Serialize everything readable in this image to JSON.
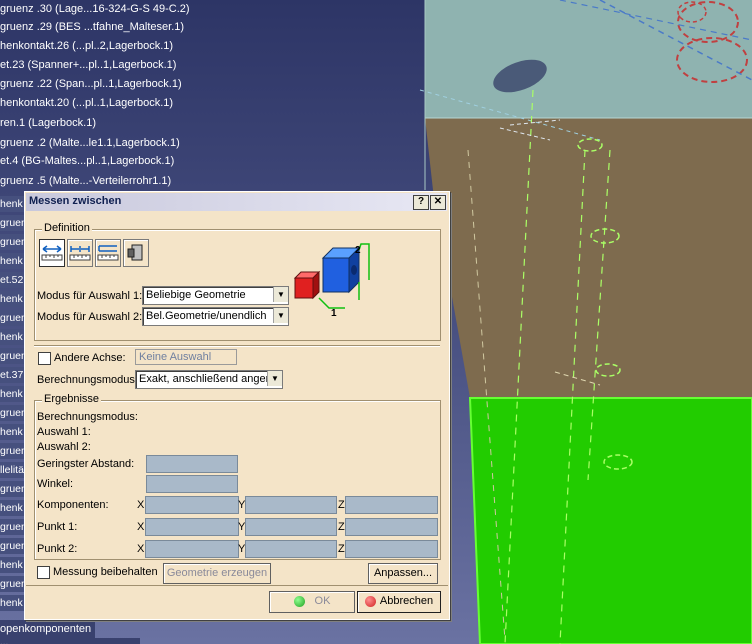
{
  "tree": {
    "items": [
      "gruenz .30 (Lage...16-324-G-S 49-C.2)",
      "gruenz .29 (BES ...tfahne_Malteser.1)",
      "henkontakt.26 (...pl..2,Lagerbock.1)",
      "et.23 (Spanner+...pl..1,Lagerbock.1)",
      "gruenz .22 (Span...pl..1,Lagerbock.1)",
      "henkontakt.20 (...pl..1,Lagerbock.1)",
      "ren.1 (Lagerbock.1)",
      "gruenz .2 (Malte...le1.1,Lagerbock.1)",
      "et.4 (BG-Maltes...pl..1,Lagerbock.1)",
      "gruenz .5 (Malte...-Verteilerrohr1.1)"
    ],
    "stubs": [
      "henk",
      "gruenz",
      "gruenz",
      "henk",
      "et.52",
      "henk",
      "gruenz",
      "henk",
      "gruenz",
      "et.37",
      "henk",
      "gruenz",
      "henk",
      "gruenz",
      "llelitä",
      "gruenz",
      "henk",
      "gruenz",
      "gruenz",
      "henk",
      "gruenz",
      "henk"
    ],
    "bottom_item": "openkomponenten",
    "bottom_item2": "..."
  },
  "dialog": {
    "title": "Messen zwischen",
    "help_btn": "?",
    "close_btn": "✕",
    "definition": {
      "legend": "Definition",
      "tool_icons": [
        "measure-between-icon",
        "measure-chain-icon",
        "measure-fan-icon",
        "measure-item-icon"
      ],
      "mode1_label": "Modus für Auswahl 1:",
      "mode1_value": "Beliebige Geometrie",
      "mode2_label": "Modus für Auswahl 2:",
      "mode2_value": "Bel.Geometrie/unendlich",
      "diagram_label_1": "1",
      "diagram_label_2": "2",
      "other_axis_label": "Andere Achse:",
      "other_axis_placeholder": "Keine Auswahl",
      "calc_mode_label": "Berechnungsmodus:",
      "calc_mode_value": "Exakt, anschließend angen"
    },
    "results": {
      "legend": "Ergebnisse",
      "calc_mode": "Berechnungsmodus:",
      "sel1": "Auswahl 1:",
      "sel2": "Auswahl 2:",
      "min_dist": "Geringster Abstand:",
      "angle": "Winkel:",
      "components": "Komponenten:",
      "point1": "Punkt 1:",
      "point2": "Punkt 2:",
      "x": "X",
      "y": "Y",
      "z": "Z"
    },
    "keep_measure": "Messung beibehalten",
    "create_geometry": "Geometrie erzeugen",
    "customize": "Anpassen...",
    "ok": "OK",
    "cancel": "Abbrechen"
  },
  "colors": {
    "dialog_bg": "#f4e4c8",
    "result_field": "#a9b9c9",
    "model_top": "#8fb3b0",
    "model_middle": "#7e6b4e",
    "model_bottom_selected": "#22cc00",
    "ok_dot": "#20a020",
    "cancel_dot": "#d02020"
  }
}
